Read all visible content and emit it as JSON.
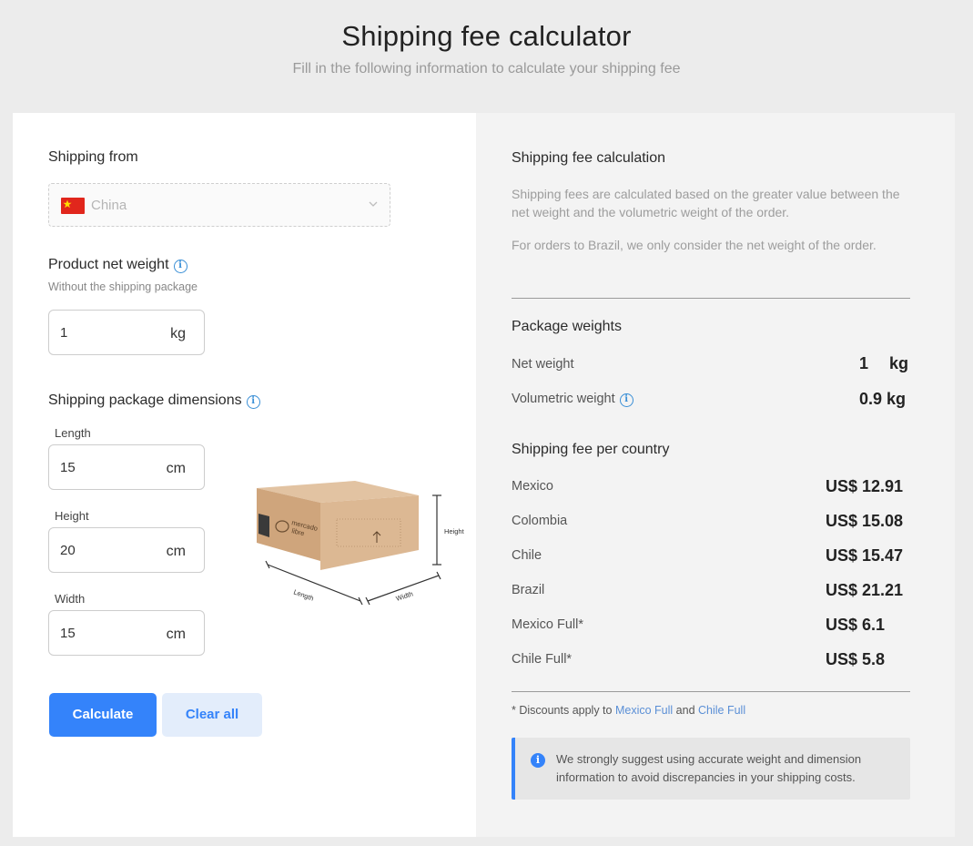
{
  "header": {
    "title": "Shipping fee calculator",
    "subtitle": "Fill in the following information to calculate your shipping fee"
  },
  "form": {
    "shipping_from_label": "Shipping from",
    "shipping_from_value": "China",
    "net_weight_label": "Product net weight",
    "net_weight_hint": "Without the shipping package",
    "net_weight_value": "1",
    "net_weight_unit": "kg",
    "dimensions_label": "Shipping package dimensions",
    "length_label": "Length",
    "length_value": "15",
    "height_label": "Height",
    "height_value": "20",
    "width_label": "Width",
    "width_value": "15",
    "dimension_unit": "cm",
    "calculate_button": "Calculate",
    "clear_button": "Clear all"
  },
  "illustration": {
    "height_label": "Height",
    "length_label": "Length",
    "width_label": "Width",
    "brand_text_1": "mercado",
    "brand_text_2": "libre"
  },
  "result": {
    "calc_heading": "Shipping fee calculation",
    "calc_desc_1": "Shipping fees are calculated based on the greater value between the net weight and the volumetric weight of the order.",
    "calc_desc_2": "For orders to Brazil, we only consider the net weight of the order.",
    "weights_heading": "Package weights",
    "net_weight_label": "Net weight",
    "net_weight_value": "1",
    "net_weight_unit": "kg",
    "volumetric_label": "Volumetric weight",
    "volumetric_value": "0.9 kg",
    "fees_heading": "Shipping fee per country",
    "fees": [
      {
        "country": "Mexico",
        "fee": "US$ 12.91"
      },
      {
        "country": "Colombia",
        "fee": "US$ 15.08"
      },
      {
        "country": "Chile",
        "fee": "US$ 15.47"
      },
      {
        "country": "Brazil",
        "fee": "US$ 21.21"
      },
      {
        "country": "Mexico Full*",
        "fee": "US$ 6.1"
      },
      {
        "country": "Chile Full*",
        "fee": "US$ 5.8"
      }
    ],
    "footnote_prefix": "* Discounts apply to",
    "footnote_link_1": "Mexico Full",
    "footnote_and": "and",
    "footnote_link_2": "Chile Full",
    "notice": "We strongly suggest using accurate weight and dimension information to avoid discrepancies in your shipping costs."
  },
  "colors": {
    "accent": "#3483fa",
    "page_bg": "#ececec",
    "flag_red": "#e1261c",
    "flag_yellow": "#ffde00",
    "box_cardboard": "#d9b48f"
  }
}
